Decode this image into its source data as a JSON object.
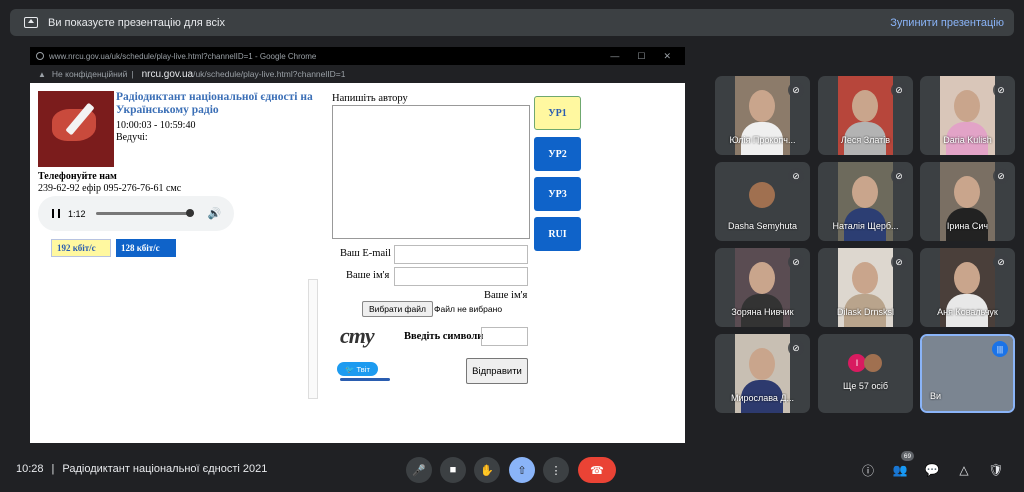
{
  "banner": {
    "text": "Ви показуєте презентацію для всіх",
    "stop": "Зупинити презентацію"
  },
  "browser": {
    "window_title": "www.nrcu.gov.ua/uk/schedule/play-live.html?channelID=1 - Google Chrome",
    "security": "Не конфіденційний",
    "host": "nrcu.gov.ua",
    "path": "/uk/schedule/play-live.html?channelID=1"
  },
  "page": {
    "title": "Радіодиктант національної єдності на Українському радіо",
    "time": "10:00:03 - 10:59:40",
    "host_label": "Ведучі:",
    "phone_heading": "Телефонуйте нам",
    "phone": "239-62-92 ефір 095-276-76-61 смс",
    "player_time": "1:12",
    "player_progress": 0.92,
    "kbps_192": "192 кбіт/с",
    "kbps_128": "128 кбіт/с",
    "write_label": "Напишіть автору",
    "channels": [
      "УР1",
      "УР2",
      "УР3",
      "RUI"
    ],
    "email_label": "Ваш E-mail",
    "name_label": "Ваше ім'я",
    "name_error": "Ваше ім'я",
    "file_button": "Вибрати файл",
    "file_status": "Файл не вибрано",
    "captcha_image": "cmy",
    "captcha_label": "Введіть символи",
    "tweet": "Твіт",
    "send": "Відправити"
  },
  "participants": [
    {
      "name": "Юлія Прокопч..."
    },
    {
      "name": "Леся Златів"
    },
    {
      "name": "Daria Kulish"
    },
    {
      "name": "Dasha Semyhuta"
    },
    {
      "name": "Наталія Щерб..."
    },
    {
      "name": "Ірина Сич"
    },
    {
      "name": "Зоряна Нивчик"
    },
    {
      "name": "Dilask Drnsksl"
    },
    {
      "name": "Аня Ковальчук"
    },
    {
      "name": "Мирослава Д..."
    },
    {
      "name": "Ще 57 осіб",
      "chip": "I"
    },
    {
      "name": "Ви"
    }
  ],
  "bottom": {
    "time": "10:28",
    "separator": "|",
    "meeting": "Радіодиктант національної єдності 2021",
    "people_count": "69"
  }
}
